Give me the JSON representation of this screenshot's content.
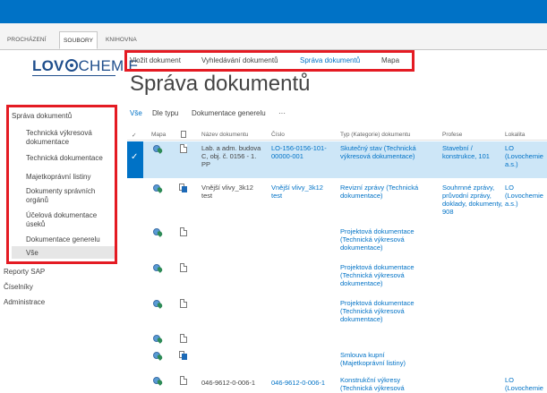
{
  "ribbon": {
    "tabs": [
      "PROCHÁZENÍ",
      "SOUBORY",
      "KNIHOVNA"
    ]
  },
  "logo": {
    "text_left": "LOV",
    "text_right": "CHEMIE"
  },
  "topnav": {
    "items": [
      "Vložit dokument",
      "Vyhledávání dokumentů",
      "Správa dokumentů",
      "Mapa"
    ]
  },
  "page": {
    "title": "Správa dokumentů"
  },
  "leftnav": {
    "heading": "Správa dokumentů",
    "items": [
      "Technická výkresová dokumentace",
      "Technická dokumentace",
      "Majetkoprávní listiny",
      "Dokumenty správních orgánů",
      "Účelová dokumentace úseků",
      "Dokumentace generelu",
      "Vše"
    ],
    "outer": [
      "Reporty SAP",
      "Číselníky",
      "Administrace"
    ]
  },
  "views": {
    "items": [
      "Vše",
      "Dle typu",
      "Dokumentace generelu",
      "···"
    ]
  },
  "table": {
    "headers": [
      "✓",
      "Mapa",
      "Název dokumentu",
      "Číslo",
      "Typ (Kategorie) dokumentu",
      "Profese",
      "Lokalita"
    ],
    "rows": [
      {
        "name": "Lab. a adm. budova C, obj. č. 0156 - 1. PP",
        "number": "LO-156-0156-101-00000-001",
        "type": "Skutečný stav (Technická výkresová dokumentace)",
        "profese": "Stavební / konstrukce, 101",
        "lokalita": "LO (Lovochemie a.s.)"
      },
      {
        "name": "Vnější vlivy_3k12 test",
        "number": "Vnější vlivy_3k12 test",
        "type": "Revizní zprávy (Technická dokumentace)",
        "profese": "Souhrnné zprávy, průvodní zprávy, doklady, dokumenty, 908",
        "lokalita": "LO (Lovochemie a.s.)"
      },
      {
        "type": "Projektová dokumentace (Technická výkresová dokumentace)"
      },
      {
        "type": "Projektová dokumentace (Technická výkresová dokumentace)"
      },
      {
        "type": "Projektová dokumentace (Technická výkresová dokumentace)"
      },
      {
        "type": ""
      },
      {
        "type": "Smlouva kupní (Majetkoprávní listiny)"
      },
      {
        "name": "046-9612-0-006-1",
        "number": "046-9612-0-006-1",
        "type": "Konstrukční výkresy (Technická výkresová",
        "lokalita": "LO (Lovochemie"
      }
    ]
  },
  "colors": {
    "suitebar": "#0072c6",
    "highlight": "#e41b23",
    "selected_row": "#cde6f7",
    "link": "#0072c6"
  }
}
